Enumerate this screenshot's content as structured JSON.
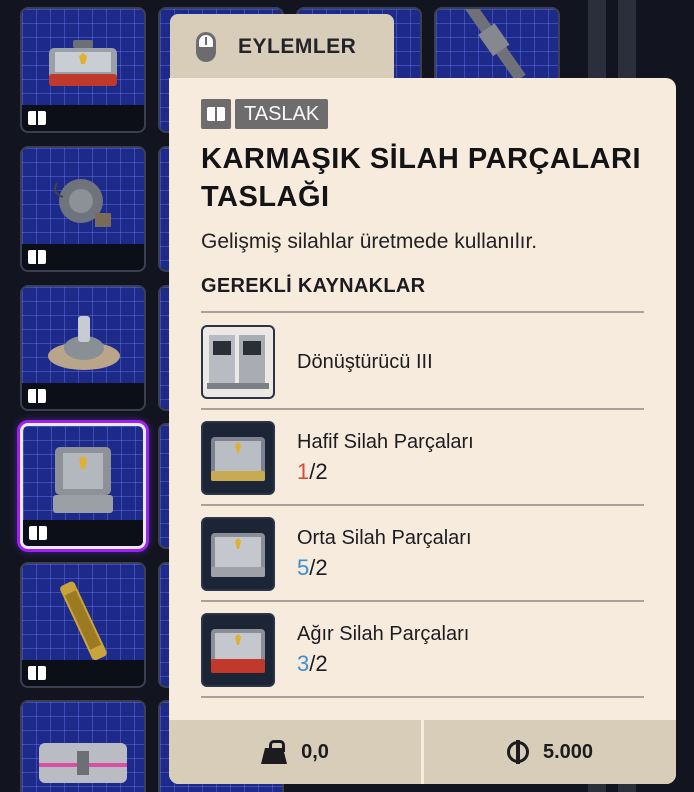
{
  "actions_tab": {
    "label": "EYLEMLER",
    "icon": "mouse-icon"
  },
  "tooltip": {
    "badge": {
      "icon": "book-icon",
      "label": "TASLAK"
    },
    "title": "KARMAŞIK SİLAH PARÇALARI TASLAĞI",
    "description": "Gelişmiş silahlar üretmede kullanılır.",
    "resources_heading": "GEREKLİ KAYNAKLAR",
    "resources": [
      {
        "name": "Dönüştürücü III",
        "have": "",
        "sep": "",
        "need": "",
        "status": "none",
        "icon": "machine-icon"
      },
      {
        "name": "Hafif Silah Parçaları",
        "have": "1",
        "sep": "/",
        "need": "2",
        "status": "low",
        "icon": "light-parts-case-icon"
      },
      {
        "name": "Orta Silah Parçaları",
        "have": "5",
        "sep": "/",
        "need": "2",
        "status": "ok",
        "icon": "medium-parts-case-icon"
      },
      {
        "name": "Ağır Silah Parçaları",
        "have": "3",
        "sep": "/",
        "need": "2",
        "status": "ok",
        "icon": "heavy-parts-case-icon"
      }
    ],
    "footer": {
      "weight": {
        "icon": "weight-icon",
        "value": "0,0"
      },
      "price": {
        "icon": "coin-icon",
        "value": "5.000"
      }
    }
  },
  "colors": {
    "panel_bg": "#f7ebde",
    "tab_bg": "#d8cdb9",
    "count_low": "#d94a3a",
    "count_ok": "#3c8fd0",
    "slot_bg": "#1d2a8a",
    "selected_glow": "#a020f0"
  }
}
